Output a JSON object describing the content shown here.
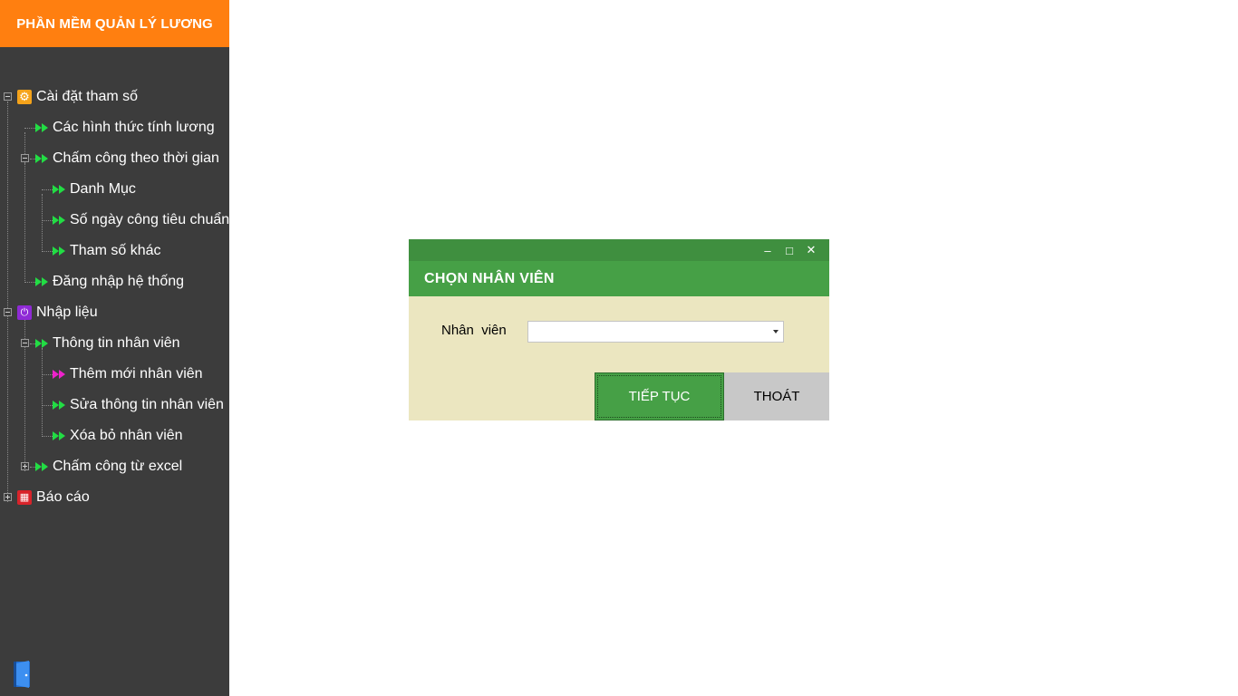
{
  "app": {
    "title": "PHẦN MỀM QUẢN LÝ LƯƠNG"
  },
  "colors": {
    "header_orange": "#ff7f10",
    "sidebar_bg": "#3c3c3c",
    "dialog_green": "#46a046",
    "dialog_titlebar": "#3f8f3f",
    "dialog_body": "#ebe6c0",
    "exit_button": "#c8c8c8",
    "arrow_green": "#22dd44",
    "arrow_magenta": "#ee22cc"
  },
  "sidebar": {
    "tree": [
      {
        "label": "Cài đặt tham số",
        "icon": "gear-icon",
        "expanded": true
      },
      {
        "label": "Các hình thức tính lương",
        "icon": "forward-arrow-icon"
      },
      {
        "label": "Chấm công theo thời gian",
        "icon": "forward-arrow-icon",
        "expanded": true
      },
      {
        "label": "Danh Mục",
        "icon": "forward-arrow-icon"
      },
      {
        "label": "Số ngày công tiêu chuẩn",
        "icon": "forward-arrow-icon"
      },
      {
        "label": "Tham số khác",
        "icon": "forward-arrow-icon"
      },
      {
        "label": "Đăng nhập hệ thống",
        "icon": "forward-arrow-icon"
      },
      {
        "label": "Nhập liệu",
        "icon": "input-icon",
        "expanded": true
      },
      {
        "label": "Thông tin nhân viên",
        "icon": "forward-arrow-icon",
        "expanded": true
      },
      {
        "label": "Thêm mới nhân viên",
        "icon": "forward-arrow-icon",
        "highlighted": true
      },
      {
        "label": "Sửa thông tin nhân viên",
        "icon": "forward-arrow-icon"
      },
      {
        "label": "Xóa bỏ nhân viên",
        "icon": "forward-arrow-icon"
      },
      {
        "label": "Chấm công từ excel",
        "icon": "forward-arrow-icon",
        "expanded": false
      },
      {
        "label": "Báo cáo",
        "icon": "report-icon",
        "expanded": false
      }
    ],
    "exit_icon": "door-exit-icon"
  },
  "dialog": {
    "title": "CHỌN NHÂN VIÊN",
    "controls": {
      "minimize": "–",
      "maximize": "□",
      "close": "✕"
    },
    "field_label": "Nhân  viên",
    "combo_value": "",
    "continue_label": "TIẾP TỤC",
    "exit_label": "THOÁT"
  }
}
